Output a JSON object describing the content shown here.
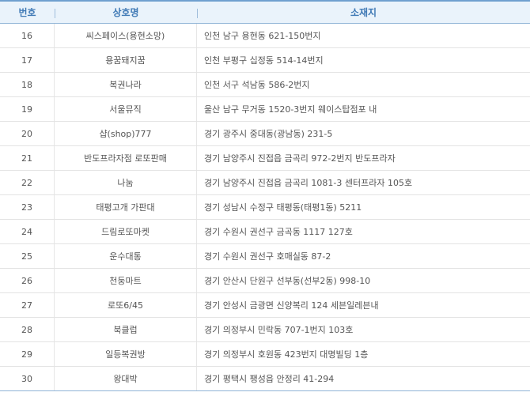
{
  "table": {
    "columns": {
      "no": "번호",
      "name": "상호명",
      "addr": "소재지"
    },
    "rows": [
      {
        "no": "16",
        "name": "씨스페이스(용현소망)",
        "addr": "인천 남구 용현동 621-150번지"
      },
      {
        "no": "17",
        "name": "용꿈돼지꿈",
        "addr": "인천 부평구 십정동 514-14번지"
      },
      {
        "no": "18",
        "name": "복권나라",
        "addr": "인천 서구 석남동 586-2번지"
      },
      {
        "no": "19",
        "name": "서울뮤직",
        "addr": "울산 남구 무거동 1520-3번지 웨이스탑점포 내"
      },
      {
        "no": "20",
        "name": "샵(shop)777",
        "addr": "경기 광주시 중대동(광남동) 231-5"
      },
      {
        "no": "21",
        "name": "반도프라자점 로또판매",
        "addr": "경기 남양주시 진접읍 금곡리 972-2번지 반도프라자"
      },
      {
        "no": "22",
        "name": "나눔",
        "addr": "경기 남양주시 진접읍 금곡리 1081-3 센터프라자 105호"
      },
      {
        "no": "23",
        "name": "태평고개 가판대",
        "addr": "경기 성남시 수정구 태평동(태평1동) 5211"
      },
      {
        "no": "24",
        "name": "드림로또마켓",
        "addr": "경기 수원시 권선구 금곡동 1117 127호"
      },
      {
        "no": "25",
        "name": "운수대통",
        "addr": "경기 수원시 권선구 호매실동 87-2"
      },
      {
        "no": "26",
        "name": "천둥마트",
        "addr": "경기 안산시 단원구 선부동(선부2동) 998-10"
      },
      {
        "no": "27",
        "name": "로또6/45",
        "addr": "경기 안성시 금광면 신양복리 124 세븐일레븐내"
      },
      {
        "no": "28",
        "name": "북클럽",
        "addr": "경기 의정부시 민락동 707-1번지 103호"
      },
      {
        "no": "29",
        "name": "일등복권방",
        "addr": "경기 의정부시 호원동 423번지 대명빌딩 1층"
      },
      {
        "no": "30",
        "name": "왕대박",
        "addr": "경기 평택시 팽성읍 안정리 41-294"
      }
    ]
  }
}
